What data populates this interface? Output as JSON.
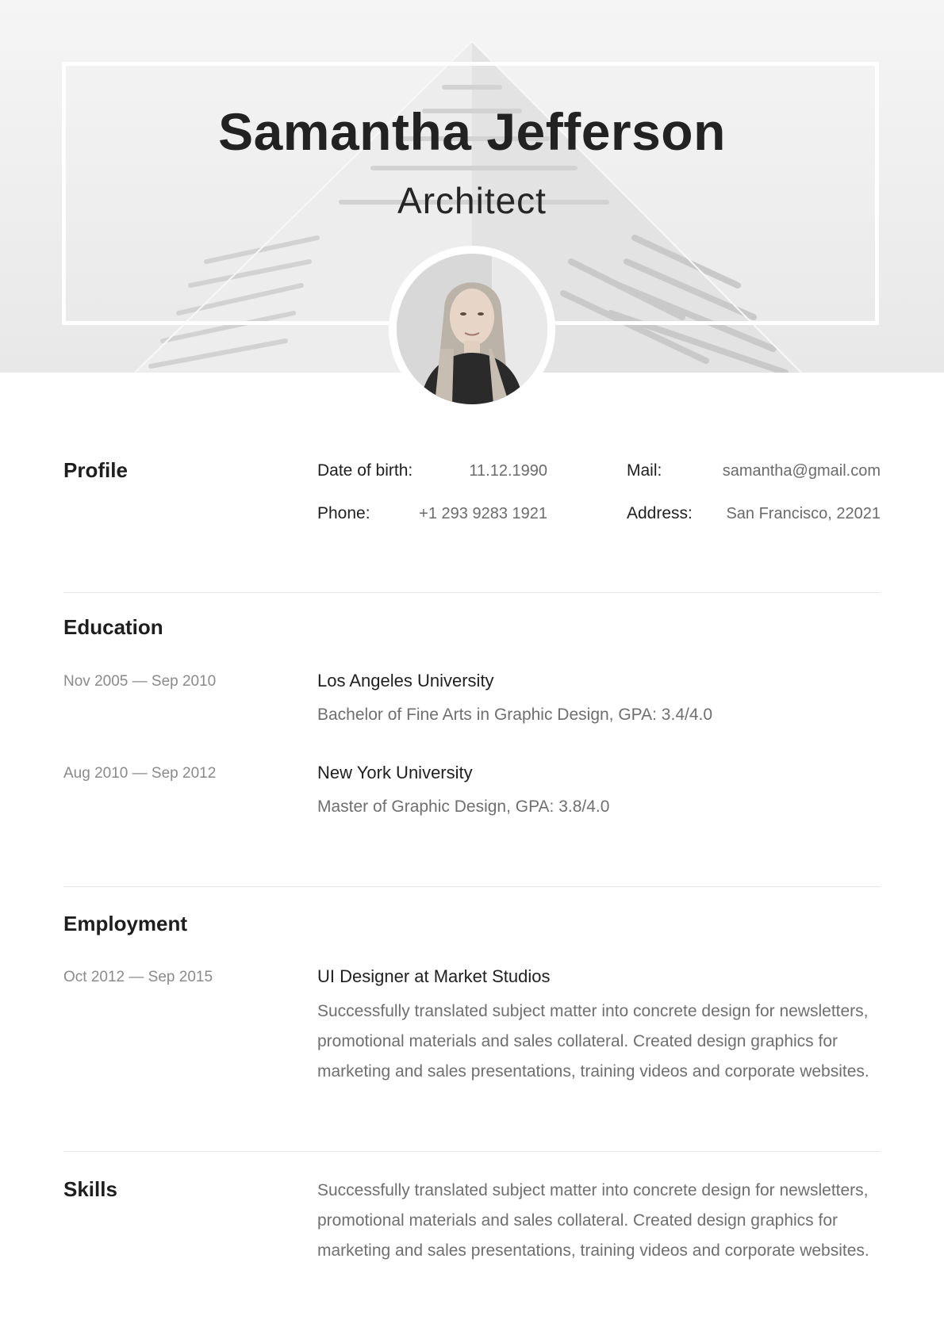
{
  "header": {
    "name": "Samantha Jefferson",
    "title": "Architect",
    "photo_icon": "portrait-photo"
  },
  "profile": {
    "heading": "Profile",
    "dob_label": "Date of birth:",
    "dob_value": "11.12.1990",
    "mail_label": "Mail:",
    "mail_value": "samantha@gmail.com",
    "phone_label": "Phone:",
    "phone_value": "+1 293 9283 1921",
    "address_label": "Address:",
    "address_value": "San Francisco, 22021"
  },
  "education": {
    "heading": "Education",
    "items": [
      {
        "dates": "Nov 2005 — Sep 2010",
        "school": "Los Angeles University",
        "degree": "Bachelor of Fine Arts in Graphic Design, GPA: 3.4/4.0"
      },
      {
        "dates": "Aug 2010 — Sep 2012",
        "school": "New York University",
        "degree": "Master of Graphic Design, GPA: 3.8/4.0"
      }
    ]
  },
  "employment": {
    "heading": "Employment",
    "items": [
      {
        "dates": "Oct 2012 — Sep 2015",
        "position": "UI Designer at Market Studios",
        "lines": [
          "Successfully translated subject matter into concrete design for newsletters,",
          "promotional materials and sales collateral. Created design graphics for",
          "marketing and sales presentations, training videos and corporate websites."
        ]
      }
    ]
  },
  "skills": {
    "heading": "Skills",
    "lines": [
      "Successfully translated subject matter into concrete design for newsletters,",
      "promotional materials and sales collateral. Created design graphics for",
      "marketing and sales presentations, training videos and corporate websites."
    ]
  },
  "colors": {
    "text_dark": "#1f1f1f",
    "text_muted": "#6f6f6f",
    "divider": "#e6e6e6"
  }
}
